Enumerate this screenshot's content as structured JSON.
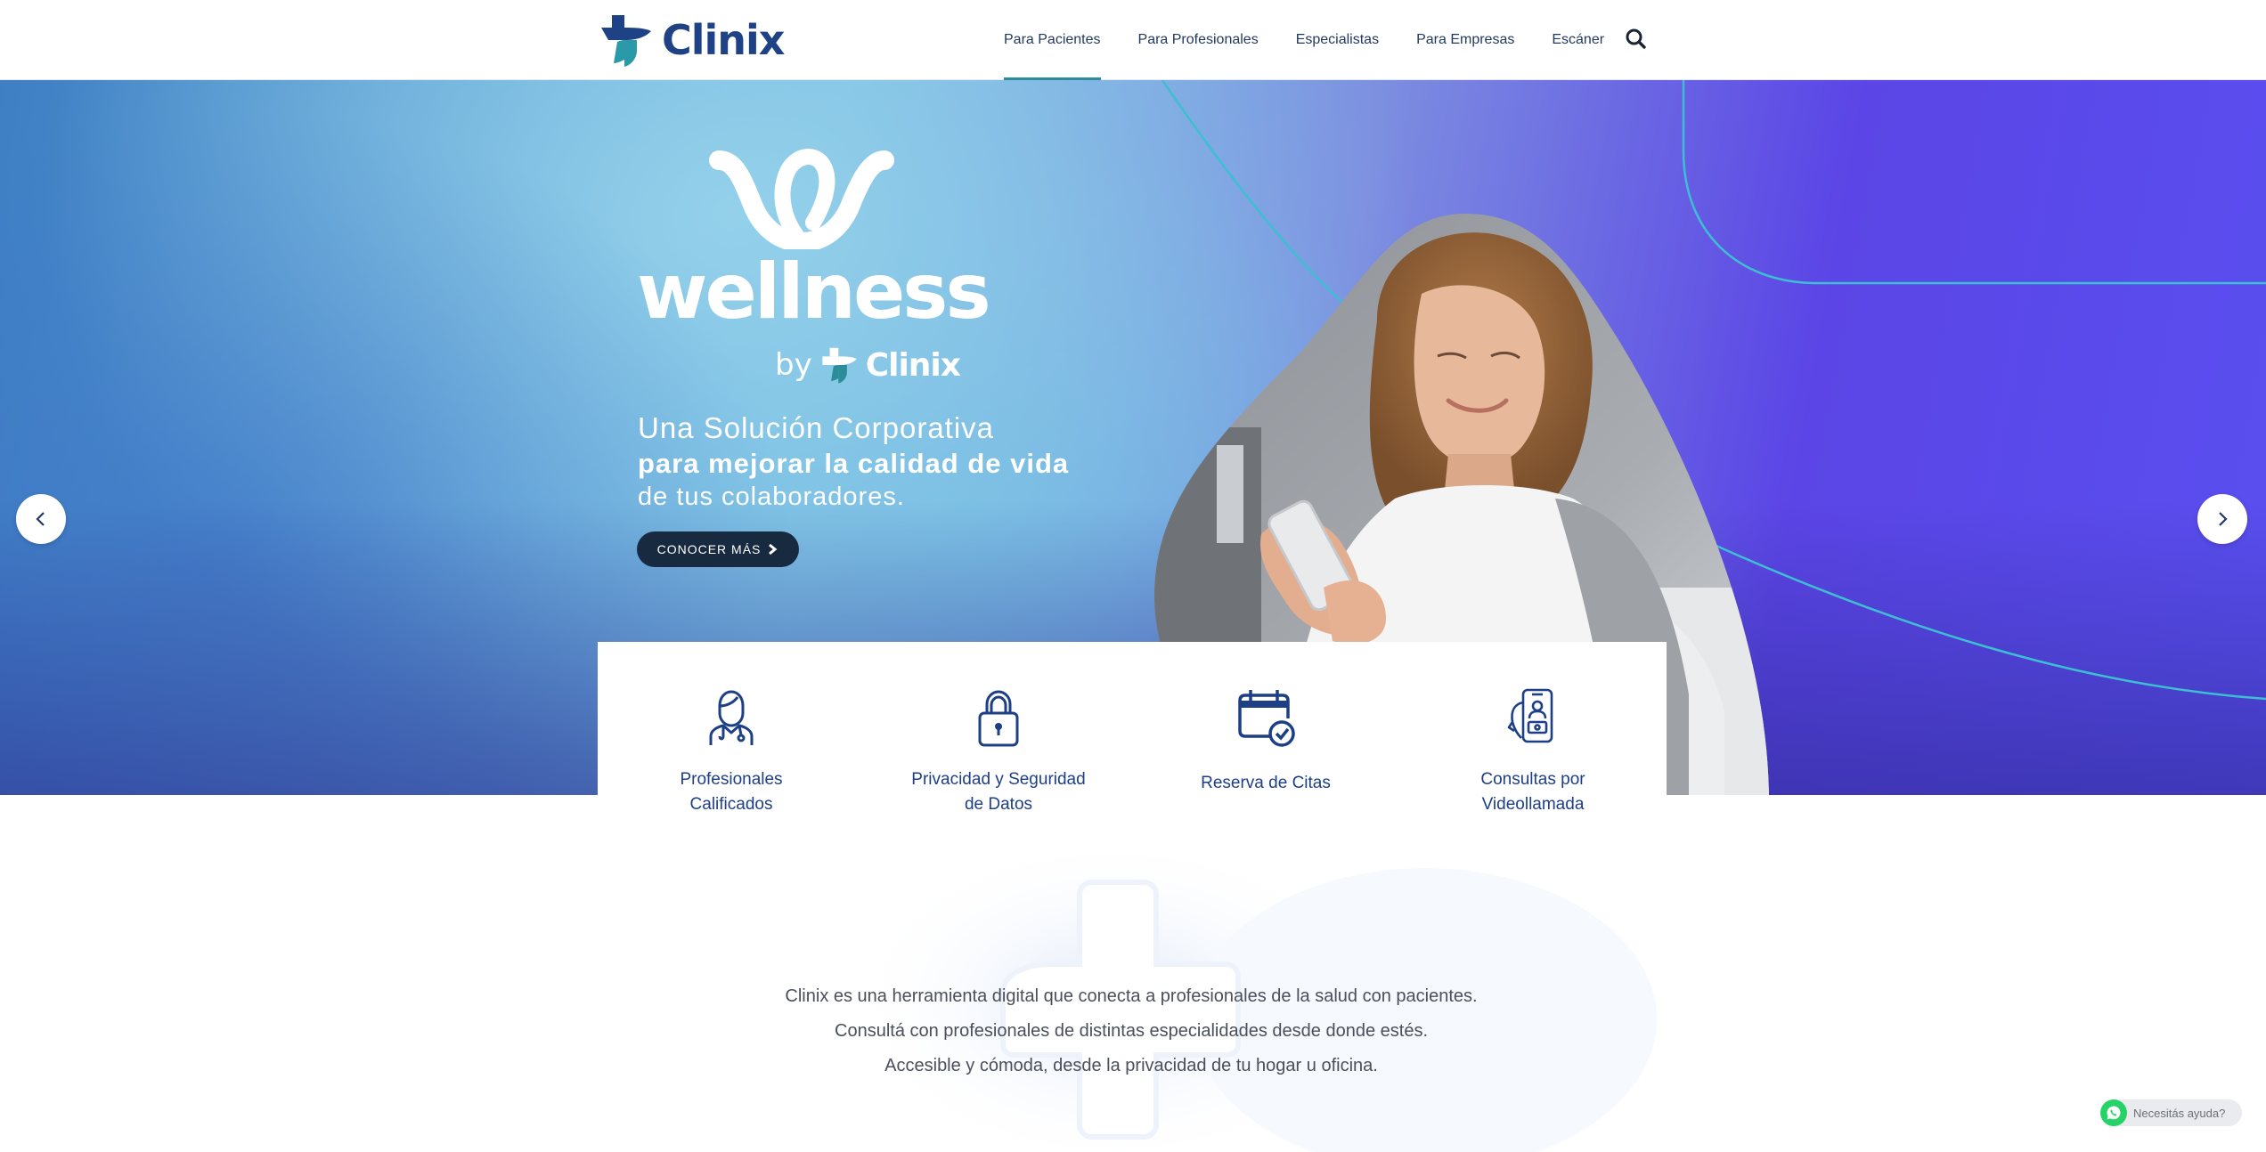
{
  "header": {
    "brand": "Clinix",
    "nav": [
      {
        "label": "Para Pacientes",
        "active": true
      },
      {
        "label": "Para Profesionales",
        "active": false
      },
      {
        "label": "Especialistas",
        "active": false
      },
      {
        "label": "Para Empresas",
        "active": false
      },
      {
        "label": "Escáner",
        "active": false
      }
    ],
    "search_icon": "search-icon"
  },
  "hero": {
    "logo_word": "wellness",
    "logo_by": "by",
    "logo_brand": "Clinix",
    "line1": "Una Solución Corporativa",
    "line2": "para mejorar la calidad de vida",
    "line3": "de tus colaboradores.",
    "cta_label": "CONOCER MÁS",
    "cta_icon": "chevron-right-icon",
    "prev_icon": "chevron-left-icon",
    "next_icon": "chevron-right-icon"
  },
  "features": [
    {
      "label": "Profesionales\nCalificados",
      "icon": "doctor-icon"
    },
    {
      "label": "Privacidad y Seguridad\nde Datos",
      "icon": "lock-icon"
    },
    {
      "label": "Reserva de Citas",
      "icon": "calendar-check-icon"
    },
    {
      "label": "Consultas por\nVideollamada",
      "icon": "video-call-icon"
    }
  ],
  "intro": {
    "p1": "Clinix es una herramienta digital que conecta a profesionales de la salud con pacientes.",
    "p2": "Consultá con profesionales de distintas especialidades desde donde estés.",
    "p3": "Accesible y cómoda, desde la privacidad de tu hogar u oficina."
  },
  "whatsapp": {
    "label": "Necesitás ayuda?",
    "icon": "whatsapp-icon"
  },
  "colors": {
    "brand_blue": "#1f4287",
    "brand_teal": "#2b8c9a",
    "cta_dark": "#182a40"
  }
}
